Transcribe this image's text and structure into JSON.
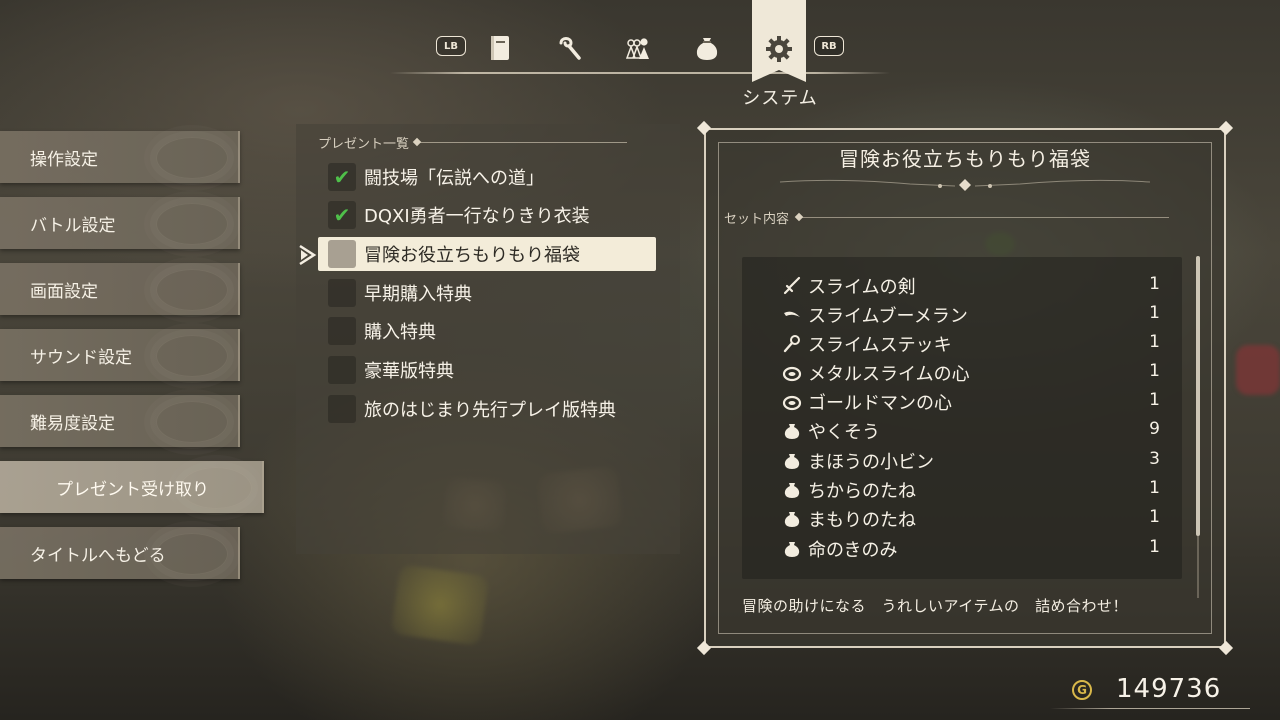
{
  "tabs": {
    "lb_label": "LB",
    "rb_label": "RB",
    "items": [
      {
        "name": "book"
      },
      {
        "name": "skill"
      },
      {
        "name": "party"
      },
      {
        "name": "bag"
      },
      {
        "name": "system"
      }
    ],
    "active_label": "システム"
  },
  "left_menu": {
    "items": [
      {
        "label": "操作設定",
        "selected": false
      },
      {
        "label": "バトル設定",
        "selected": false
      },
      {
        "label": "画面設定",
        "selected": false
      },
      {
        "label": "サウンド設定",
        "selected": false
      },
      {
        "label": "難易度設定",
        "selected": false
      },
      {
        "label": "プレゼント受け取り",
        "selected": true
      },
      {
        "label": "タイトルへもどる",
        "selected": false
      }
    ]
  },
  "present_list": {
    "title": "プレゼント一覧",
    "items": [
      {
        "label": "闘技場「伝説への道」",
        "received": true,
        "selected": false
      },
      {
        "label": "DQXI勇者一行なりきり衣装",
        "received": true,
        "selected": false
      },
      {
        "label": "冒険お役立ちもりもり福袋",
        "received": false,
        "selected": true
      },
      {
        "label": "早期購入特典",
        "received": false,
        "selected": false
      },
      {
        "label": "購入特典",
        "received": false,
        "selected": false
      },
      {
        "label": "豪華版特典",
        "received": false,
        "selected": false
      },
      {
        "label": "旅のはじまり先行プレイ版特典",
        "received": false,
        "selected": false
      }
    ]
  },
  "detail": {
    "title": "冒険お役立ちもりもり福袋",
    "set_label": "セット内容",
    "items": [
      {
        "icon": "sword-icon",
        "name": "スライムの剣",
        "qty": "1"
      },
      {
        "icon": "boomerang-icon",
        "name": "スライムブーメラン",
        "qty": "1"
      },
      {
        "icon": "staff-icon",
        "name": "スライムステッキ",
        "qty": "1"
      },
      {
        "icon": "ring-icon",
        "name": "メタルスライムの心",
        "qty": "1"
      },
      {
        "icon": "ring-icon",
        "name": "ゴールドマンの心",
        "qty": "1"
      },
      {
        "icon": "pouch-icon",
        "name": "やくそう",
        "qty": "9"
      },
      {
        "icon": "pouch-icon",
        "name": "まほうの小ビン",
        "qty": "3"
      },
      {
        "icon": "pouch-icon",
        "name": "ちからのたね",
        "qty": "1"
      },
      {
        "icon": "pouch-icon",
        "name": "まもりのたね",
        "qty": "1"
      },
      {
        "icon": "pouch-icon",
        "name": "命のきのみ",
        "qty": "1"
      }
    ],
    "description": "冒険の助けになる　うれしいアイテムの　詰め合わせ！"
  },
  "gold": {
    "symbol": "G",
    "value": "149736"
  },
  "colors": {
    "check": "#4fc04a",
    "gold": "#d9b84a",
    "selected_bg": "#f3ecd9"
  }
}
